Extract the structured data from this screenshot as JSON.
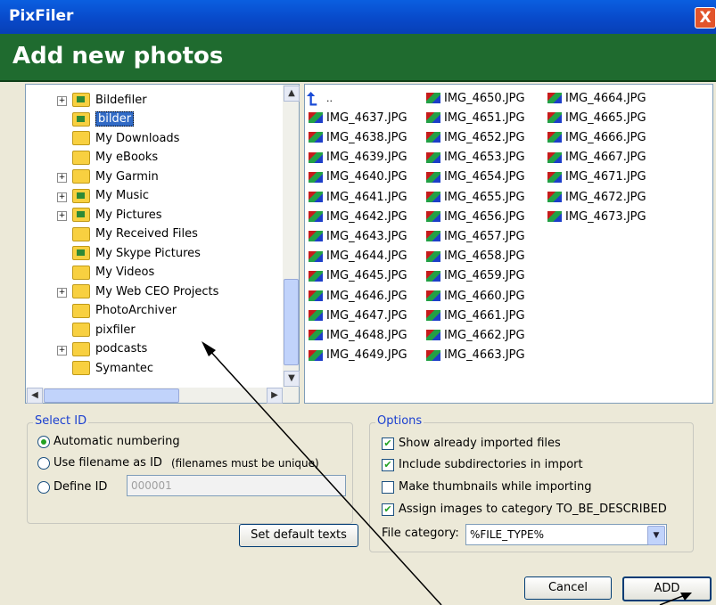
{
  "window": {
    "title": "PixFiler",
    "heading": "Add new photos",
    "close_glyph": "X"
  },
  "tree": {
    "items": [
      {
        "label": "Bildefiler",
        "expander": "+",
        "special": true
      },
      {
        "label": "bilder",
        "expander": "",
        "special": true,
        "selected": true
      },
      {
        "label": "My Downloads",
        "expander": "",
        "special": false
      },
      {
        "label": "My eBooks",
        "expander": "",
        "special": false
      },
      {
        "label": "My Garmin",
        "expander": "+",
        "special": false
      },
      {
        "label": "My Music",
        "expander": "+",
        "special": true
      },
      {
        "label": "My Pictures",
        "expander": "+",
        "special": true
      },
      {
        "label": "My Received Files",
        "expander": "",
        "special": false
      },
      {
        "label": "My Skype Pictures",
        "expander": "",
        "special": true
      },
      {
        "label": "My Videos",
        "expander": "",
        "special": false
      },
      {
        "label": "My Web CEO Projects",
        "expander": "+",
        "special": false
      },
      {
        "label": "PhotoArchiver",
        "expander": "",
        "special": false
      },
      {
        "label": "pixfiler",
        "expander": "",
        "special": false
      },
      {
        "label": "podcasts",
        "expander": "+",
        "special": false
      },
      {
        "label": "Symantec",
        "expander": "",
        "special": false
      }
    ]
  },
  "files": {
    "up_glyph": "⮤",
    "up_label": "..",
    "columns": [
      [
        "IMG_4637.JPG",
        "IMG_4638.JPG",
        "IMG_4639.JPG",
        "IMG_4640.JPG",
        "IMG_4641.JPG",
        "IMG_4642.JPG",
        "IMG_4643.JPG",
        "IMG_4644.JPG",
        "IMG_4645.JPG",
        "IMG_4646.JPG",
        "IMG_4647.JPG",
        "IMG_4648.JPG",
        "IMG_4649.JPG"
      ],
      [
        "IMG_4650.JPG",
        "IMG_4651.JPG",
        "IMG_4652.JPG",
        "IMG_4653.JPG",
        "IMG_4654.JPG",
        "IMG_4655.JPG",
        "IMG_4656.JPG",
        "IMG_4657.JPG",
        "IMG_4658.JPG",
        "IMG_4659.JPG",
        "IMG_4660.JPG",
        "IMG_4661.JPG",
        "IMG_4662.JPG",
        "IMG_4663.JPG"
      ],
      [
        "IMG_4664.JPG",
        "IMG_4665.JPG",
        "IMG_4666.JPG",
        "IMG_4667.JPG",
        "IMG_4671.JPG",
        "IMG_4672.JPG",
        "IMG_4673.JPG"
      ]
    ]
  },
  "select_id": {
    "title": "Select ID",
    "automatic": "Automatic numbering",
    "filename": "Use filename as ID",
    "filename_note": "(filenames must be unique)",
    "define": "Define ID",
    "define_value": "000001",
    "selected": "automatic"
  },
  "options": {
    "title": "Options",
    "show_imported": {
      "label": "Show already imported files",
      "checked": true
    },
    "include_subdirs": {
      "label": "Include subdirectories in import",
      "checked": true
    },
    "thumbnails": {
      "label": "Make thumbnails while importing",
      "checked": false
    },
    "assign_category": {
      "label": "Assign images to category TO_BE_DESCRIBED",
      "checked": true
    },
    "file_category_label": "File category:",
    "file_category_value": "%FILE_TYPE%"
  },
  "buttons": {
    "default_texts": "Set default texts",
    "cancel": "Cancel",
    "add": "ADD"
  },
  "scroll_glyphs": {
    "up": "▲",
    "down": "▼",
    "left": "◀",
    "right": "▶",
    "dropdown": "▼"
  }
}
